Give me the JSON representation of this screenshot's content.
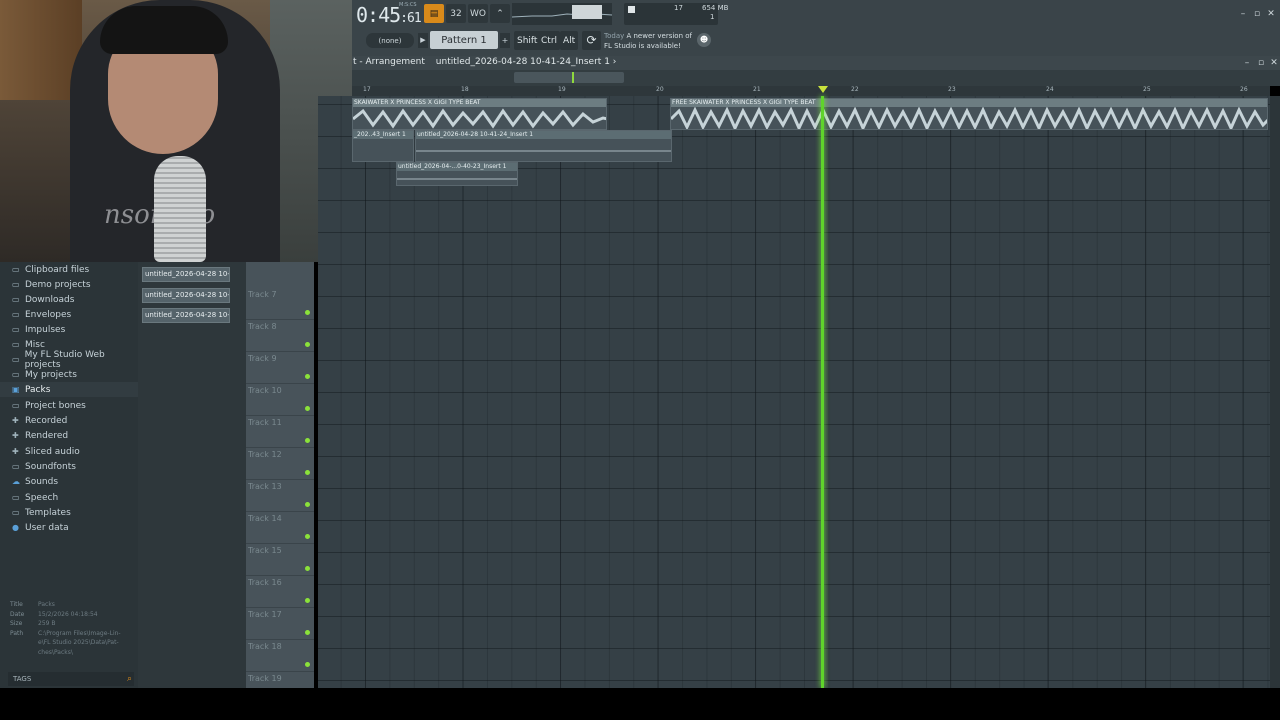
{
  "toolbar": {
    "time": "0:45",
    "time_small": ":61",
    "time_unit": "M:S:CS",
    "cpu_value": "17",
    "memory": "654 MB",
    "polyphony": "1",
    "pattern_none": "(none)",
    "pattern_name": "Pattern 1",
    "mod_shift": "Shift",
    "mod_ctrl": "Ctrl",
    "mod_alt": "Alt",
    "news_label": "Today",
    "news_line1": "A newer version of",
    "news_line2": "FL Studio is available!",
    "btn_song": "32",
    "btn_metronome": "WO",
    "accent": "#d98a1a"
  },
  "playlist": {
    "title": "t - Arrangement",
    "breadcrumb": "untitled_2026-04-28 10-41-24_Insert 1",
    "breadcrumb_arrow": "›",
    "bars": [
      "17",
      "18",
      "19",
      "20",
      "21",
      "22",
      "23",
      "24",
      "25",
      "26"
    ],
    "clips": {
      "clip1": "SKAIWATER X PRINCESS X GIGI TYPE BEAT",
      "clip2": "FREE SKAIWATER X PRINCESS X GIGI TYPE BEAT",
      "clip3": "_202..43_Insert 1",
      "clip4": "untitled_2026-04-28 10-41-24_Insert 1",
      "clip5": "untitled_2026-04-...0-40-23_Insert 1"
    },
    "tracks": [
      "Track 7",
      "Track 8",
      "Track 9",
      "Track 10",
      "Track 11",
      "Track 12",
      "Track 13",
      "Track 14",
      "Track 15",
      "Track 16",
      "Track 17",
      "Track 18",
      "Track 19"
    ],
    "playhead_color": "#5fd42b"
  },
  "browser": {
    "items": [
      {
        "label": "Clipboard files",
        "icon": "folder-icon"
      },
      {
        "label": "Demo projects",
        "icon": "folder-icon"
      },
      {
        "label": "Downloads",
        "icon": "folder-icon"
      },
      {
        "label": "Envelopes",
        "icon": "folder-icon"
      },
      {
        "label": "Impulses",
        "icon": "folder-icon"
      },
      {
        "label": "Misc",
        "icon": "folder-icon"
      },
      {
        "label": "My FL Studio Web projects",
        "icon": "folder-icon"
      },
      {
        "label": "My projects",
        "icon": "folder-icon"
      },
      {
        "label": "Packs",
        "icon": "pack-folder-icon"
      },
      {
        "label": "Project bones",
        "icon": "folder-icon"
      },
      {
        "label": "Recorded",
        "icon": "plus-icon"
      },
      {
        "label": "Rendered",
        "icon": "plus-icon"
      },
      {
        "label": "Sliced audio",
        "icon": "plus-icon"
      },
      {
        "label": "Soundfonts",
        "icon": "folder-icon"
      },
      {
        "label": "Sounds",
        "icon": "cloud-icon"
      },
      {
        "label": "Speech",
        "icon": "folder-icon"
      },
      {
        "label": "Templates",
        "icon": "folder-icon"
      },
      {
        "label": "User data",
        "icon": "user-icon"
      }
    ],
    "info": {
      "title_label": "Title",
      "title_value": "Packs",
      "date_label": "Date",
      "date_value": "15/2/2026 04:18:54",
      "size_label": "Size",
      "size_value": "259 B",
      "path_label": "Path",
      "path_line1": "C:\\Program Files\\Image-Lin-",
      "path_line2": "e\\FL Studio 2025\\Data\\Pat-",
      "path_line3": "ches\\Packs\\"
    },
    "tags_label": "TAGS"
  },
  "picker": {
    "items": [
      "untitled_2026-04-28 10-...",
      "untitled_2026-04-28 10-...",
      "untitled_2026-04-28 10-..."
    ]
  },
  "webcam": {
    "shirt_text": "nsomnio"
  }
}
